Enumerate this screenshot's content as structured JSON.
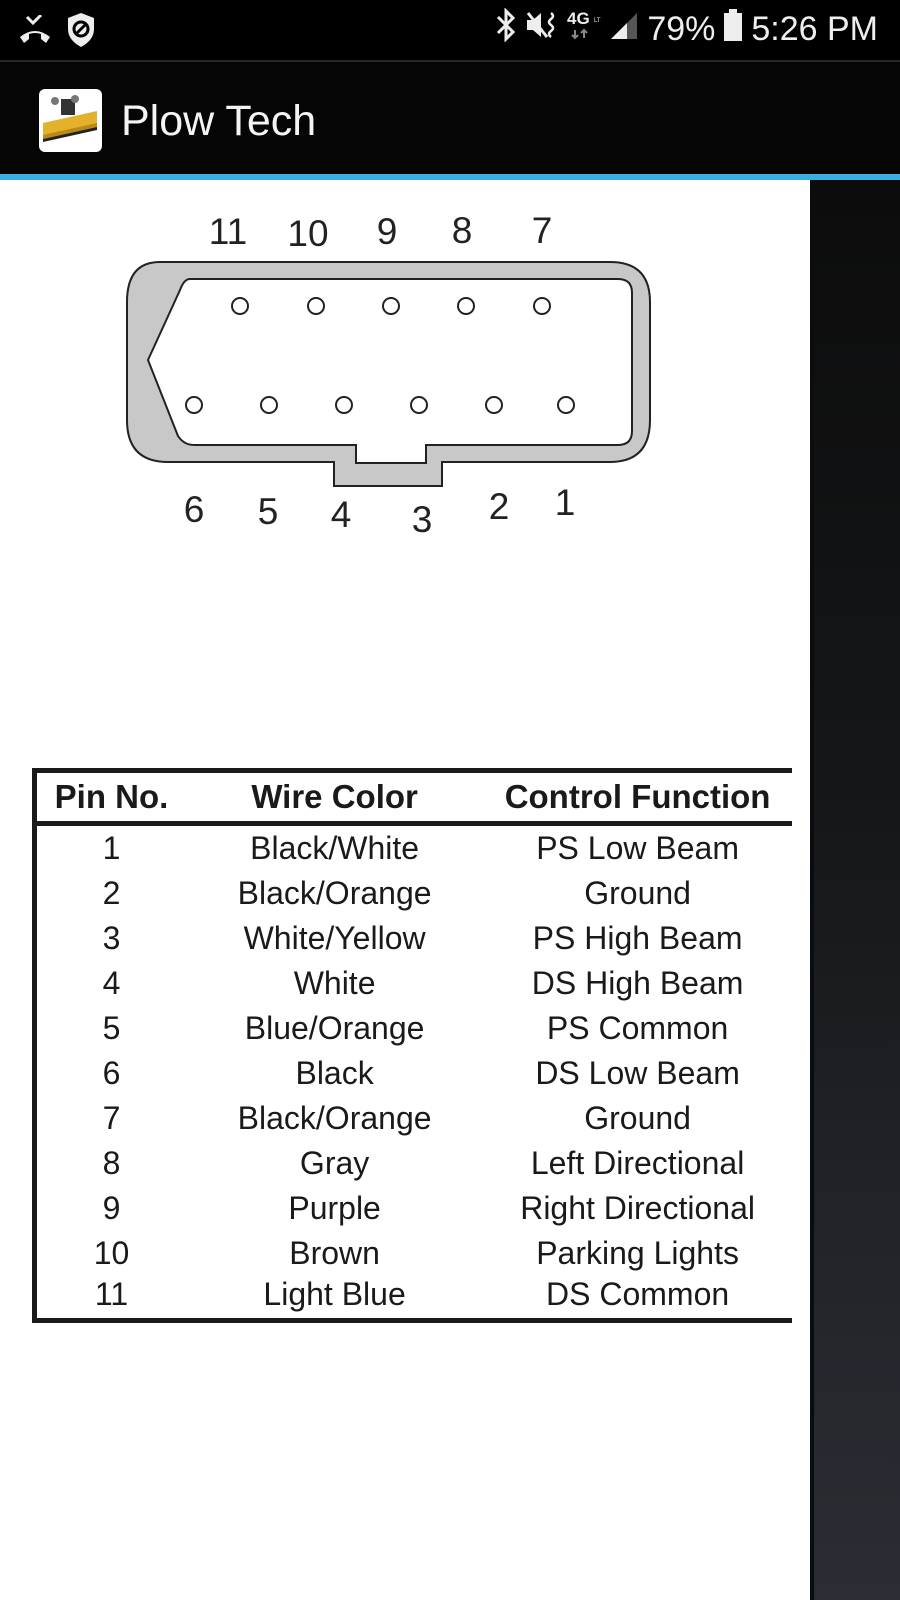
{
  "status_bar": {
    "left_icons": [
      "missed-call-icon",
      "shield-block-icon"
    ],
    "right_icons": [
      "bluetooth-icon",
      "vibrate-mute-icon",
      "4g-lte-icon",
      "signal-icon"
    ],
    "network": "4G",
    "battery_percent": "79%",
    "battery_level": 0.79,
    "time": "5:26 PM"
  },
  "app_bar": {
    "icon": "snow-plow-icon",
    "title": "Plow Tech"
  },
  "colors": {
    "accent": "#3aaee0",
    "connector_fill": "#c8c8c8",
    "outline": "#222222"
  },
  "connector": {
    "top_row_labels": [
      "11",
      "10",
      "9",
      "8",
      "7"
    ],
    "bottom_row_labels": [
      "6",
      "5",
      "4",
      "3",
      "2",
      "1"
    ]
  },
  "table": {
    "headers": [
      "Pin No.",
      "Wire Color",
      "Control Function"
    ],
    "rows": [
      {
        "pin": "1",
        "wire": "Black/White",
        "function": "PS Low Beam"
      },
      {
        "pin": "2",
        "wire": "Black/Orange",
        "function": "Ground"
      },
      {
        "pin": "3",
        "wire": "White/Yellow",
        "function": "PS High Beam"
      },
      {
        "pin": "4",
        "wire": "White",
        "function": "DS High Beam"
      },
      {
        "pin": "5",
        "wire": "Blue/Orange",
        "function": "PS Common"
      },
      {
        "pin": "6",
        "wire": "Black",
        "function": "DS Low Beam"
      },
      {
        "pin": "7",
        "wire": "Black/Orange",
        "function": "Ground"
      },
      {
        "pin": "8",
        "wire": "Gray",
        "function": "Left Directional"
      },
      {
        "pin": "9",
        "wire": "Purple",
        "function": "Right Directional"
      },
      {
        "pin": "10",
        "wire": "Brown",
        "function": "Parking Lights"
      },
      {
        "pin": "11",
        "wire": "Light Blue",
        "function": "DS Common"
      }
    ]
  }
}
